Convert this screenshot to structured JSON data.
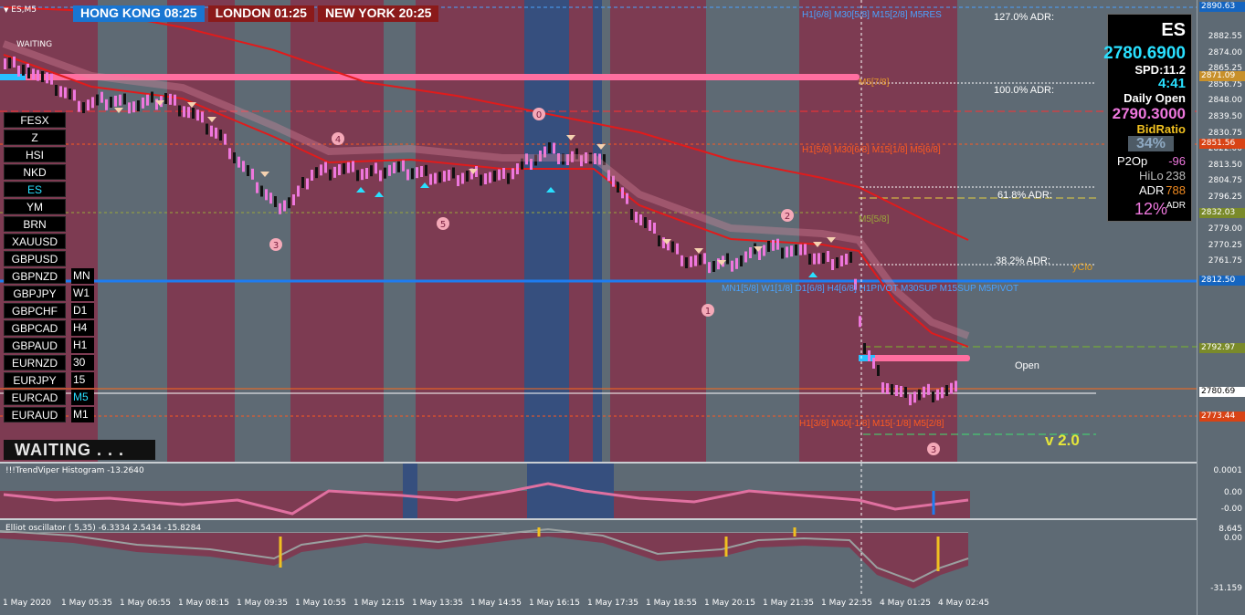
{
  "window": {
    "title": "ES,M5",
    "waiting_small": "WAITING"
  },
  "sessions": [
    {
      "label": "HONG KONG 08:25",
      "color": "#1976d2"
    },
    {
      "label": "LONDON  01:25",
      "color": "#8b1a1a"
    },
    {
      "label": "NEW YORK  20:25",
      "color": "#8b1a1a"
    }
  ],
  "symbols": [
    "FESX",
    "Z",
    "HSI",
    "NKD",
    "ES",
    "YM",
    "BRN",
    "XAUUSD",
    "GBPUSD",
    "GBPNZD",
    "GBPJPY",
    "GBPCHF",
    "GBPCAD",
    "GBPAUD",
    "EURNZD",
    "EURJPY",
    "EURCAD",
    "EURAUD"
  ],
  "active_symbol": "ES",
  "timeframes": [
    "MN",
    "W1",
    "D1",
    "H4",
    "H1",
    "30",
    "15",
    "M5",
    "M1"
  ],
  "active_timeframe": "M5",
  "status": {
    "waiting": "WAITING . . ."
  },
  "version": "v 2.0",
  "info": {
    "symbol": "ES",
    "price": "2780.6900",
    "spread": "SPD:11.2",
    "timer": "4:41",
    "daily_open_label": "Daily Open",
    "daily_open": "2790.3000",
    "bid_ratio_label": "BidRatio",
    "bid_ratio": "34%",
    "p2op_label": "P2Op",
    "p2op": "-96",
    "hilo_label": "HiLo",
    "hilo": "238",
    "adr_label": "ADR",
    "adr": "788",
    "pct": "12%",
    "pct_label": "ADR"
  },
  "adr_labels": {
    "a127": "127.0% ADR:",
    "a100": "100.0% ADR:",
    "a618": "61.8% ADR:",
    "a382": "38.2% ADR:"
  },
  "level_labels": {
    "h1_68": "H1[6/8] M30[5/8] M15[2/8] M5RES",
    "m5_78": "M5[7/8]",
    "h1_58": "H1[5/8] M30[6/8] M15[1/8] M5[6/8]",
    "m5_58": "M5[5/8]",
    "pivot": "MN1[5/8] W1[1/8] D1[6/8] H4[6/8] H1PIVOT M30SUP M15SUP M5PIVOT",
    "h1_38": "H1[3/8] M30[-1/8] M15[-1/8] M5[2/8]",
    "yclo": "yClo",
    "open": "Open"
  },
  "wave_labels": [
    "3",
    "4",
    "5",
    "0",
    "1",
    "2",
    "3"
  ],
  "price_axis": {
    "ticks": [
      "2882.55",
      "2874.00",
      "2865.25",
      "2856.75",
      "2848.00",
      "2839.50",
      "2830.75",
      "2822.00",
      "2813.50",
      "2804.75",
      "2796.25",
      "2787.50",
      "2779.00",
      "2770.25",
      "2761.75"
    ],
    "tags": [
      {
        "text": "2890.63",
        "color": "#1565c0"
      },
      {
        "text": "2871.09",
        "color": "#c8902a"
      },
      {
        "text": "2851.56",
        "color": "#d84315"
      },
      {
        "text": "2832.03",
        "color": "#7a8a2a"
      },
      {
        "text": "2812.50",
        "color": "#1565c0"
      },
      {
        "text": "2792.97",
        "color": "#7a8a2a"
      },
      {
        "text": "2780.69",
        "color": "#ffffff"
      },
      {
        "text": "2773.44",
        "color": "#d84315"
      }
    ]
  },
  "histogram": {
    "title": "!!!TrendViper Histogram -13.2640",
    "ticks": [
      "0.0001",
      "0.00",
      "-0.00"
    ]
  },
  "elliot": {
    "title": "Elliot oscillator ( 5,35) -6.3334 2.5434 -15.8284",
    "ticks": [
      "8.645",
      "0.00",
      "-31.159"
    ]
  },
  "time_axis": [
    "1 May 2020",
    "1 May 05:35",
    "1 May 06:55",
    "1 May 08:15",
    "1 May 09:35",
    "1 May 10:55",
    "1 May 12:15",
    "1 May 13:35",
    "1 May 14:55",
    "1 May 16:15",
    "1 May 17:35",
    "1 May 18:55",
    "1 May 20:15",
    "1 May 21:35",
    "1 May 22:55",
    "4 May 01:25",
    "4 May 02:45"
  ],
  "colors": {
    "session_red": "#7d3b52",
    "session_blue": "#364f7e",
    "ma": "#e11b1b",
    "candle_up": "#ee77dd",
    "candle_dn": "#111111",
    "pink_zone": "#ff6fa0"
  }
}
